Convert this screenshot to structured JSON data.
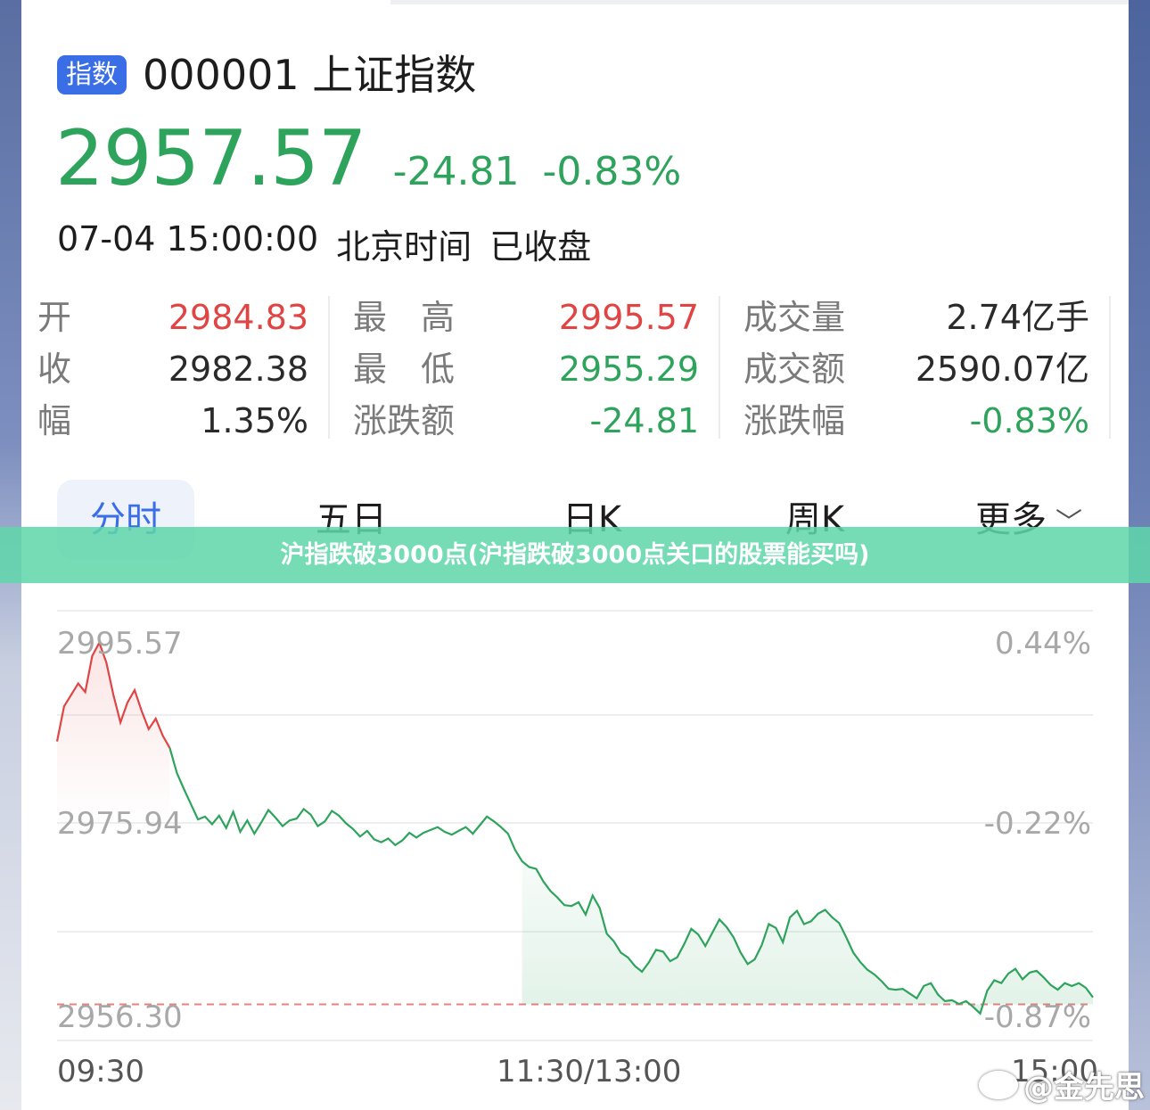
{
  "header": {
    "badge": "指数",
    "code_name": "000001 上证指数"
  },
  "quote": {
    "price": "2957.57",
    "change": "-24.81",
    "change_pct": "-0.83%"
  },
  "status": {
    "datetime": "07-04 15:00:00",
    "timezone": "北京时间",
    "state": "已收盘"
  },
  "stats": [
    [
      {
        "label": "开",
        "value": "2984.83",
        "color": "red"
      },
      {
        "label": "收",
        "value": "2982.38",
        "color": "black"
      },
      {
        "label": "幅",
        "value": "1.35%",
        "color": "black"
      }
    ],
    [
      {
        "label": "最　高",
        "value": "2995.57",
        "color": "red"
      },
      {
        "label": "最　低",
        "value": "2955.29",
        "color": "green"
      },
      {
        "label": "涨跌额",
        "value": "-24.81",
        "color": "green"
      }
    ],
    [
      {
        "label": "成交量",
        "value": "2.74亿手",
        "color": "black"
      },
      {
        "label": "成交额",
        "value": "2590.07亿",
        "color": "black"
      },
      {
        "label": "涨跌幅",
        "value": "-0.83%",
        "color": "green"
      }
    ]
  ],
  "tabs": [
    "分时",
    "五日",
    "日K",
    "周K",
    "更多"
  ],
  "banner": "沪指跌破3000点(沪指跌破3000点关口的股票能买吗)",
  "chart_data": {
    "type": "line",
    "title": "",
    "prev_close": 2982.38,
    "ylim": [
      2956.3,
      2995.57
    ],
    "y_ticks_left": [
      "2995.57",
      "2975.94",
      "2956.30"
    ],
    "y_ticks_right": [
      "0.44%",
      "-0.22%",
      "-0.87%"
    ],
    "reference_line": 2957.57,
    "x_ticks": [
      "09:30",
      "11:30/13:00",
      "15:00"
    ],
    "grid": true,
    "colors": {
      "above": "#e04545",
      "below": "#2ea35c",
      "ref": "#e88080"
    },
    "series": [
      {
        "y": [
          2985.2,
          2988.9,
          2990.1,
          2991.3,
          2990.4,
          2994.2,
          2995.57,
          2993.5,
          2990.1,
          2987.2,
          2989.3,
          2990.6,
          2988.4,
          2986.5,
          2987.6,
          2985.8,
          2984.5,
          2981.9,
          2980.2,
          2978.6,
          2977.0,
          2977.3,
          2976.5,
          2977.4,
          2976.1,
          2977.8,
          2975.7,
          2976.9,
          2975.5,
          2976.7,
          2978.0,
          2977.2,
          2976.3,
          2976.9,
          2977.1,
          2978.1,
          2977.5,
          2976.3,
          2976.8,
          2977.9,
          2977.4,
          2976.6,
          2976.0,
          2975.2,
          2975.8,
          2974.9,
          2974.6,
          2975.0,
          2974.3,
          2974.8,
          2975.6,
          2975.1,
          2975.6,
          2975.9,
          2976.2,
          2975.7,
          2975.4,
          2975.8,
          2976.2,
          2975.5,
          2976.4,
          2977.3,
          2976.8,
          2976.2,
          2975.5,
          2973.8,
          2972.6,
          2972.0,
          2971.8,
          2970.5,
          2969.5,
          2968.8,
          2968.0,
          2967.9,
          2968.3,
          2967.0,
          2969.0,
          2967.7,
          2965.0,
          2964.2,
          2963.0,
          2962.5,
          2961.6,
          2961.0,
          2962.0,
          2963.3,
          2963.1,
          2962.1,
          2962.5,
          2963.9,
          2965.5,
          2964.9,
          2963.7,
          2965.1,
          2966.5,
          2965.7,
          2964.6,
          2963.0,
          2961.8,
          2962.3,
          2963.8,
          2966.0,
          2965.6,
          2964.1,
          2966.7,
          2967.4,
          2966.0,
          2966.3,
          2967.1,
          2967.5,
          2966.7,
          2966.1,
          2964.6,
          2963.0,
          2962.0,
          2961.2,
          2960.7,
          2960.0,
          2959.2,
          2959.1,
          2959.2,
          2958.7,
          2958.2,
          2959.5,
          2959.8,
          2958.6,
          2957.9,
          2958.0,
          2957.6,
          2957.9,
          2957.3,
          2956.6,
          2959.0,
          2960.1,
          2959.8,
          2960.8,
          2961.3,
          2960.2,
          2960.9,
          2961.1,
          2960.4,
          2959.6,
          2959.1,
          2959.8,
          2959.5,
          2959.8,
          2959.3,
          2958.3
        ]
      }
    ]
  },
  "axis_labels": {
    "start": "09:30",
    "mid": "11:30/13:00",
    "end": "15:00"
  },
  "watermark": "@金先思"
}
